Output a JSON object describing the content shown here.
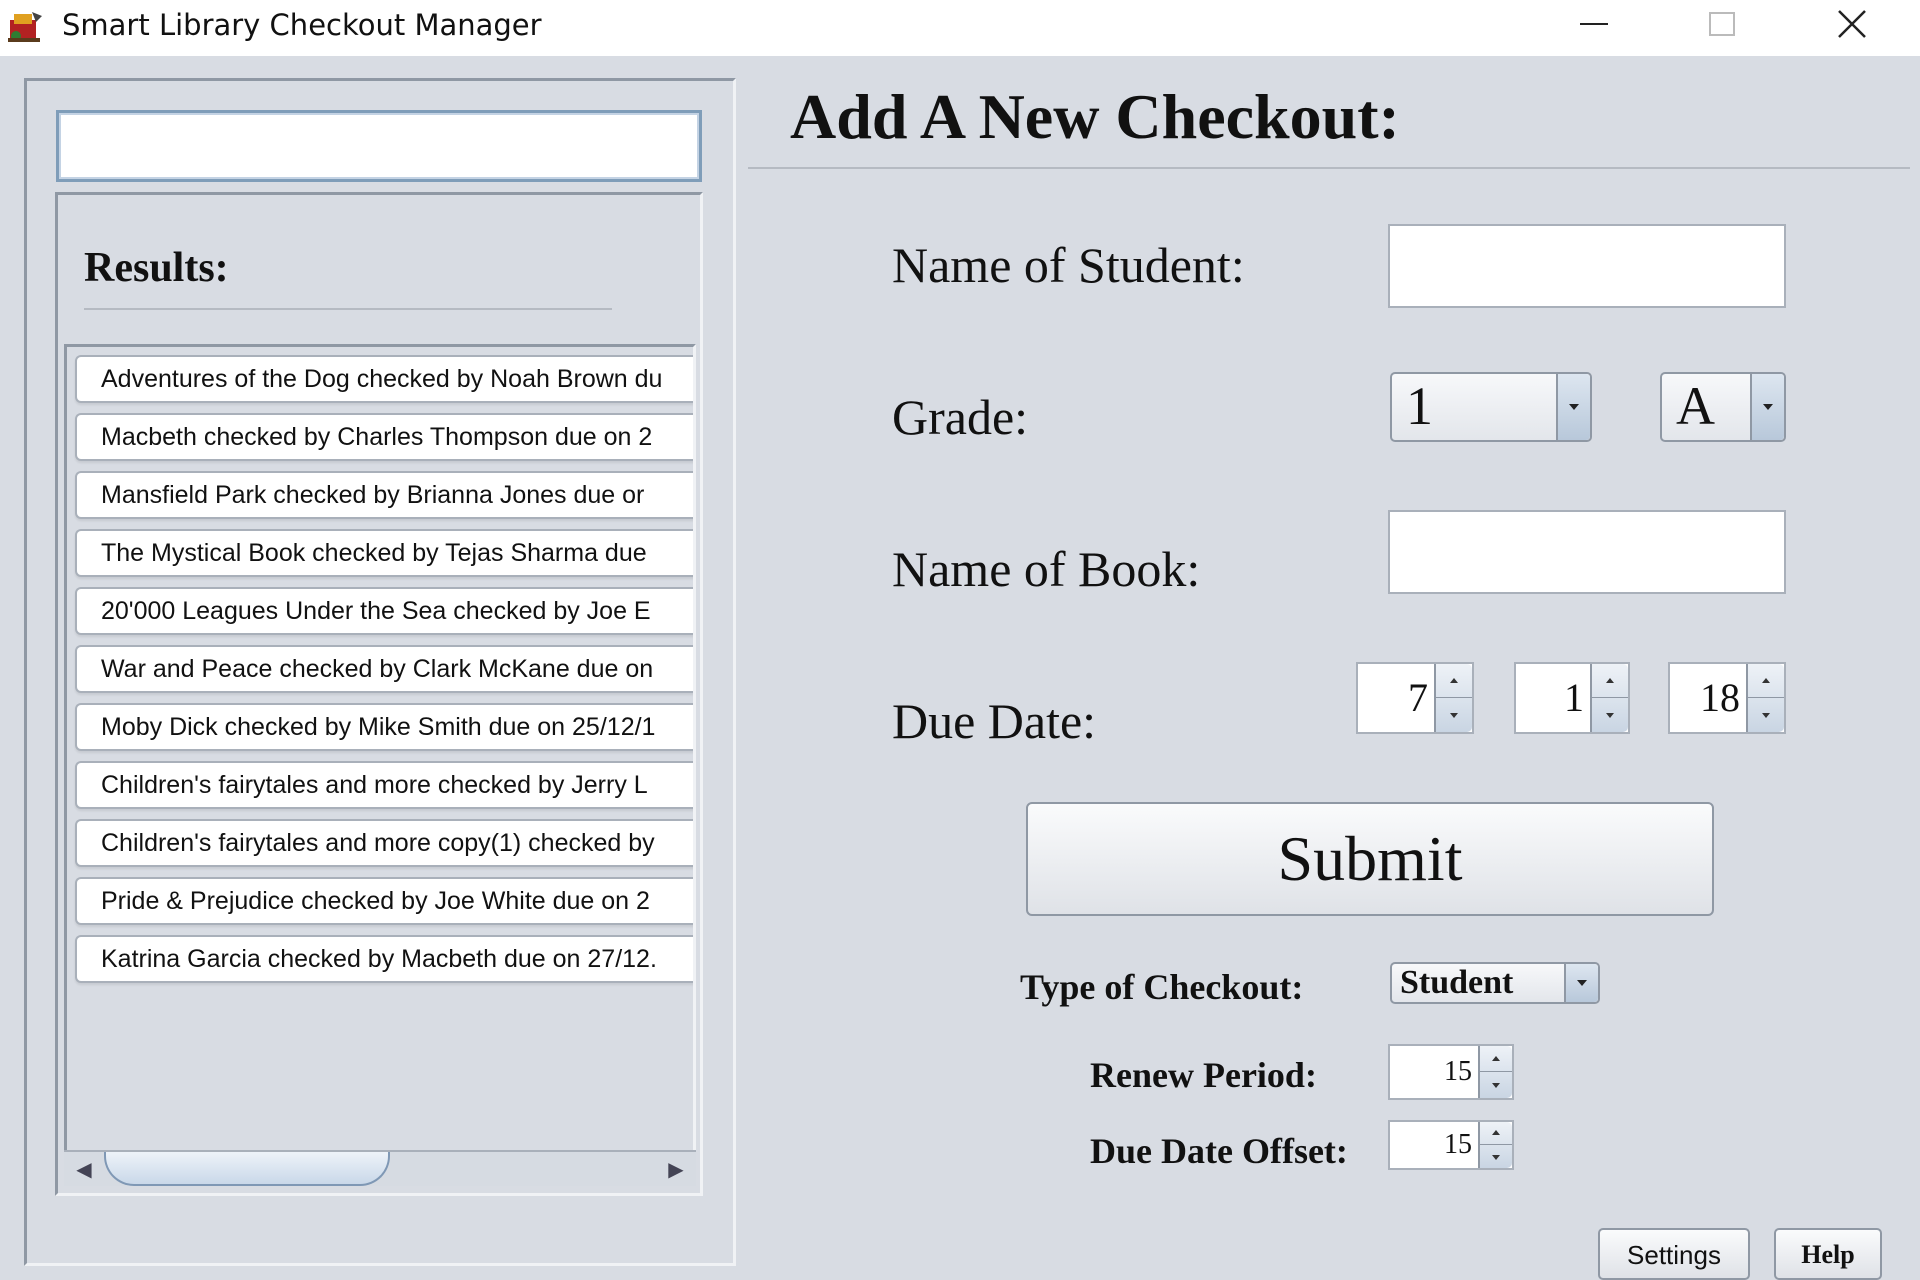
{
  "window": {
    "title": "Smart Library Checkout Manager"
  },
  "search": {
    "value": "",
    "placeholder": ""
  },
  "results": {
    "title": "Results:",
    "items": [
      "Adventures of the Dog checked by Noah Brown du",
      "Macbeth checked by Charles Thompson due on 2",
      "Mansfield Park checked by Brianna Jones due or",
      "The Mystical Book checked by Tejas Sharma due",
      "20'000 Leagues Under the Sea checked by Joe E",
      "War and Peace checked by Clark McKane due on",
      "Moby Dick checked by Mike Smith due on 25/12/1",
      "Children's fairytales and more checked by Jerry L",
      "Children's fairytales and more copy(1) checked by",
      "Pride & Prejudice checked by Joe White due on 2",
      "Katrina Garcia checked by Macbeth due on 27/12."
    ]
  },
  "form": {
    "title": "Add A New Checkout:",
    "student_label": "Name of Student:",
    "student_value": "",
    "grade_label": "Grade:",
    "grade_value": "1",
    "section_value": "A",
    "book_label": "Name of Book:",
    "book_value": "",
    "due_label": "Due Date:",
    "due_day": "7",
    "due_month": "1",
    "due_year": "18",
    "submit_label": "Submit",
    "type_label": "Type of Checkout:",
    "type_value": "Student",
    "renew_label": "Renew Period:",
    "renew_value": "15",
    "offset_label": "Due Date Offset:",
    "offset_value": "15"
  },
  "footer": {
    "settings_label": "Settings",
    "help_label": "Help"
  },
  "icons": {
    "app": "app-logo-icon",
    "minimize": "minimize-icon",
    "maximize": "maximize-icon",
    "close": "close-icon"
  }
}
